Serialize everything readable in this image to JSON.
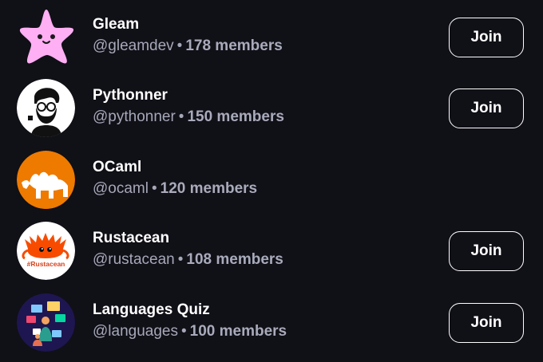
{
  "communities": [
    {
      "name": "Gleam",
      "handle": "@gleamdev",
      "separator": "•",
      "members": "178 members",
      "join_label": "Join",
      "avatar_icon": "pink-star-icon",
      "avatar_bg": "#ffaff3"
    },
    {
      "name": "Pythonner",
      "handle": "@pythonner",
      "separator": "•",
      "members": "150 members",
      "join_label": "Join",
      "avatar_icon": "bearded-man-icon",
      "avatar_bg": "#ffffff"
    },
    {
      "name": "OCaml",
      "handle": "@ocaml",
      "separator": "•",
      "members": "120 members",
      "join_label": "",
      "avatar_icon": "camel-icon",
      "avatar_bg": "#ee7a00"
    },
    {
      "name": "Rustacean",
      "handle": "@rustacean",
      "separator": "•",
      "members": "108 members",
      "join_label": "Join",
      "avatar_icon": "ferris-crab-icon",
      "avatar_bg": "#ffffff",
      "avatar_text": "#Rustacean"
    },
    {
      "name": "Languages Quiz",
      "handle": "@languages",
      "separator": "•",
      "members": "100 members",
      "join_label": "Join",
      "avatar_icon": "quiz-illustration-icon",
      "avatar_bg": "#1e1650"
    }
  ]
}
